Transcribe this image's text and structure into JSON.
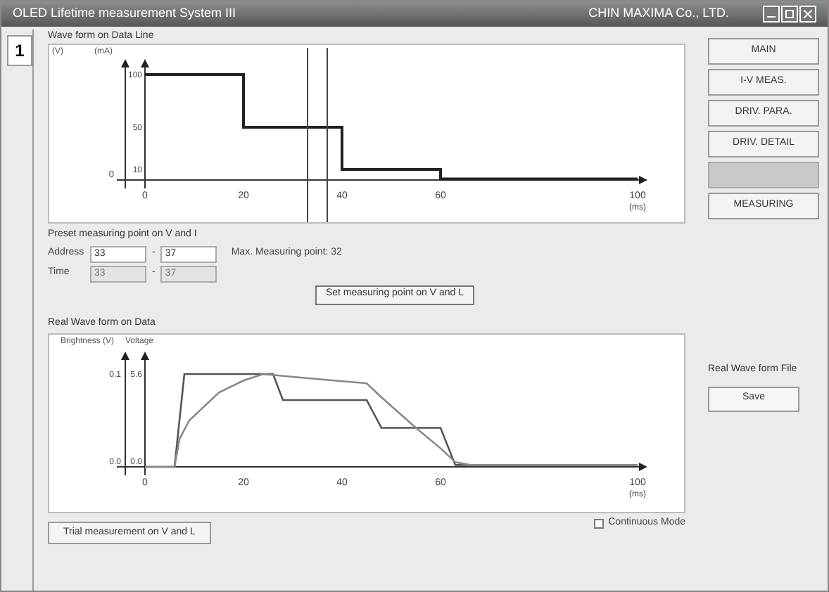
{
  "window": {
    "title": "OLED Lifetime measurement System III",
    "company": "CHIN MAXIMA Co., LTD."
  },
  "tabs": [
    {
      "label": "1",
      "selected": true
    }
  ],
  "wave_form_panel": {
    "title": "Wave form on Data Line",
    "left_axis_label": "(V)",
    "right_axis_label": "(mA)",
    "origin_label": "0",
    "y_ticks": [
      "100",
      "50",
      "10"
    ],
    "x_ticks": [
      "0",
      "20",
      "40",
      "60",
      "100"
    ],
    "x_unit": "(ms)"
  },
  "preset": {
    "title": "Preset measuring point on V and I",
    "rows": [
      {
        "label": "Address",
        "from": "33",
        "to": "37",
        "disabled": false
      },
      {
        "label": "Time",
        "from": "33",
        "to": "37",
        "disabled": true
      }
    ],
    "separator": "-",
    "max_point": "Max. Measuring point: 32",
    "button": "Set measuring point on V and L"
  },
  "real_wave_panel": {
    "title": "Real Wave form on Data",
    "legend": [
      "Brightness (V)",
      "Voltage"
    ],
    "left_axis_ticks": [
      "0.1",
      "0.0"
    ],
    "right_axis_ticks": [
      "5.6",
      "0.0"
    ],
    "x_ticks": [
      "0",
      "20",
      "40",
      "60",
      "100"
    ],
    "x_unit": "(ms)"
  },
  "nav_buttons": [
    {
      "label": "MAIN",
      "disabled": false
    },
    {
      "label": "I-V MEAS.",
      "disabled": false
    },
    {
      "label": "DRIV. PARA.",
      "disabled": false
    },
    {
      "label": "DRIV. DETAIL",
      "disabled": false
    },
    {
      "disabled": true
    },
    {
      "label": "MEASURING",
      "disabled": false
    }
  ],
  "file_panel": {
    "title": "Real Wave form File",
    "button": "Save"
  },
  "continuous_mode": {
    "label": "Continuous Mode",
    "checked": false
  },
  "trial_button": "Trial measurement on V and L"
}
